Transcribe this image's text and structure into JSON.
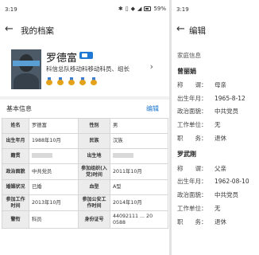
{
  "left": {
    "status_time": "3:19",
    "battery": "59%",
    "title": "我的档案",
    "profile": {
      "name": "罗德富",
      "subtitle": "科信总队移动科移动科员、组长"
    },
    "section_title": "基本信息",
    "edit_label": "编辑",
    "rows": [
      {
        "l1": "姓名",
        "v1": "罗德富",
        "l2": "性别",
        "v2": "男"
      },
      {
        "l1": "出生年月",
        "v1": "1988年10月",
        "l2": "民族",
        "v2": "汉族"
      },
      {
        "l1": "籍贯",
        "v1": "",
        "l2": "出生地",
        "v2": ""
      },
      {
        "l1": "政治面貌",
        "v1": "中共党员",
        "l2": "参加组织(入党)时间",
        "v2": "2011年10月"
      },
      {
        "l1": "婚姻状况",
        "v1": "已婚",
        "l2": "血型",
        "v2": "A型"
      },
      {
        "l1": "参加工作时间",
        "v1": "2013年10月",
        "l2": "参加公安工作时间",
        "v2": "2014年10月"
      },
      {
        "l1": "警衔",
        "v1": "科员",
        "l2": "身份证号",
        "v2": "44092111 ... 20 0588"
      }
    ]
  },
  "right": {
    "status_time": "3:19",
    "title": "编辑",
    "section_label": "家庭信息",
    "members": [
      {
        "name": "曾丽娟",
        "fields": [
          {
            "label": "称　　谓：",
            "value": "母亲"
          },
          {
            "label": "出生年月：",
            "value": "1965-8-12"
          },
          {
            "label": "政治面貌：",
            "value": "中共党员"
          },
          {
            "label": "工作单位：",
            "value": "无"
          },
          {
            "label": "职　　务：",
            "value": "退休"
          }
        ]
      },
      {
        "name": "罗武刚",
        "fields": [
          {
            "label": "称　　谓：",
            "value": "父亲"
          },
          {
            "label": "出生年月：",
            "value": "1962-08-10"
          },
          {
            "label": "政治面貌：",
            "value": "中共党员"
          },
          {
            "label": "工作单位：",
            "value": "无"
          },
          {
            "label": "职　　务：",
            "value": "退休"
          }
        ]
      }
    ]
  }
}
